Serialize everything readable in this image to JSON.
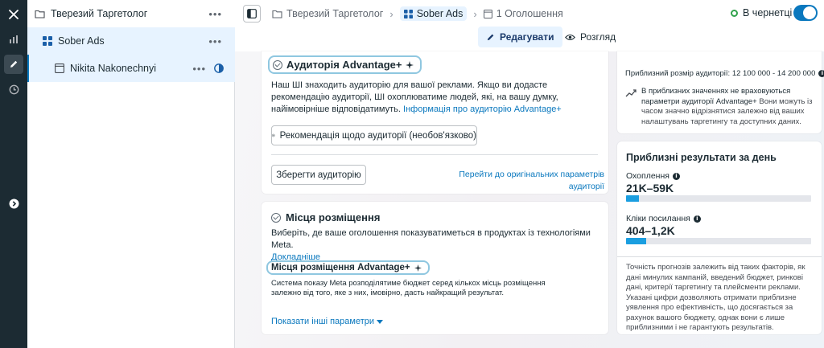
{
  "tree": {
    "campaign": {
      "label": "Тверезий Таргетолог",
      "more": "•••"
    },
    "adset": {
      "label": "Sober Ads",
      "more": "•••"
    },
    "ad": {
      "label": "Nikita Nakonechnyi",
      "more": "•••"
    }
  },
  "header": {
    "breadcrumbs": [
      "Тверезий Таргетолог",
      "Sober Ads",
      "1 Оголошення"
    ],
    "status_label": "В чернетці",
    "edit_label": "Редагувати",
    "view_label": "Розгляд"
  },
  "audience": {
    "title": "Аудиторія Advantage+",
    "description": "Наш ШІ знаходить аудиторію для вашої реклами. Якщо ви додасте рекомендацію аудиторії, ШІ охоплюватиме людей, які, на вашу думку, найімовірніше відповідатимуть.",
    "info_link": "Інформація про аудиторію Advantage+",
    "suggestion_button": "Рекомендація щодо аудиторії (необов'язково)",
    "save_button": "Зберегти аудиторію",
    "original_link": "Перейти до оригінальних параметрів аудиторії"
  },
  "placements": {
    "title": "Місця розміщення",
    "description": "Виберіть, де ваше оголошення показуватиметься в продуктах із технологіями Meta.",
    "more_link": "Докладніше",
    "advantage_title": "Місця розміщення Advantage+",
    "advantage_description": "Система показу Meta розподілятиме бюджет серед кількох місць розміщення залежно від того, яке з них, імовірно, дасть найкращий результат.",
    "show_more": "Показати інші параметри"
  },
  "audience_size": {
    "label": "Приблизний розмір аудиторії: 12 100 000 - 14 200 000",
    "note_bold": "В приблизних значеннях не враховуються параметри аудиторії Advantage+",
    "note_rest": " Вони можуть із часом значно відрізнятися залежно від ваших налаштувань таргетингу та доступних даних."
  },
  "daily_results": {
    "title": "Приблизні результати за день",
    "reach_label": "Охоплення",
    "reach_value": "21K–59K",
    "reach_fill": 0.07,
    "clicks_label": "Кліки посилання",
    "clicks_value": "404–1,2K",
    "clicks_fill": 0.11,
    "disclaimer": "Точність прогнозів залежить від таких факторів, як дані минулих кампаній, введений бюджет, ринкові дані, критерії таргетингу та плейсменти реклами. Указані цифри дозволяють отримати приблизне уявлення про ефективність, що досягається за рахунок вашого бюджету, однак вони є лише приблизними і не гарантують результатів."
  },
  "colors": {
    "accent": "#0a78be",
    "rail": "#1c2b33",
    "selected": "#e7f3ff",
    "bar": "#1a9ee0",
    "status": "#31a24c"
  },
  "icons": [
    "close-icon",
    "chart-icon",
    "pencil-icon",
    "clock-icon",
    "expand-icon",
    "folder-icon",
    "grid-icon",
    "ad-icon",
    "contrast-icon",
    "panel-icon",
    "eye-icon",
    "sparkle-icon",
    "plus-circle-icon",
    "info-icon",
    "trend-icon",
    "caret-down-icon"
  ]
}
